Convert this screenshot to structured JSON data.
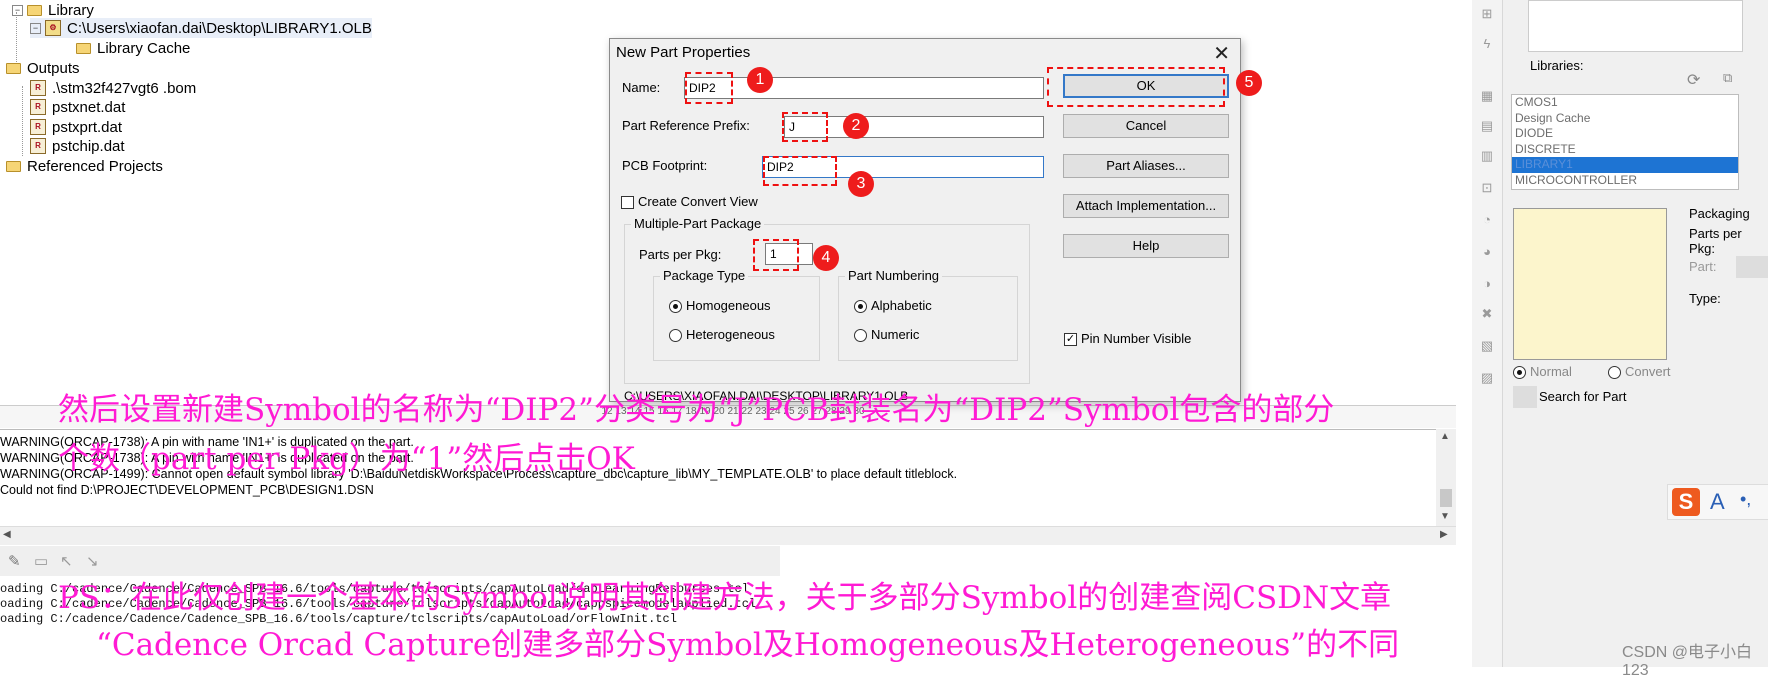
{
  "tree": {
    "items": [
      {
        "label": "Library",
        "type": "folder"
      },
      {
        "label": "C:\\Users\\xiaofan.dai\\Desktop\\LIBRARY1.OLB",
        "type": "olb"
      },
      {
        "label": "Library Cache",
        "type": "folder"
      },
      {
        "label": "Outputs",
        "type": "folder"
      },
      {
        "label": ".\\stm32f427vgt6 .bom",
        "type": "file"
      },
      {
        "label": "pstxnet.dat",
        "type": "file"
      },
      {
        "label": "pstxprt.dat",
        "type": "file"
      },
      {
        "label": "pstchip.dat",
        "type": "file"
      },
      {
        "label": "Referenced Projects",
        "type": "folder"
      }
    ]
  },
  "dialog": {
    "title": "New Part Properties",
    "close_glyph": "✕",
    "name_label": "Name:",
    "name_value": "DIP2",
    "prefix_label": "Part Reference Prefix:",
    "prefix_value": "J",
    "footprint_label": "PCB Footprint:",
    "footprint_value": "DIP2",
    "convert_label": "Create Convert View",
    "multi_title": "Multiple-Part Package",
    "parts_label": "Parts per Pkg:",
    "parts_value": "1",
    "pkg_type_title": "Package Type",
    "homogeneous": "Homogeneous",
    "heterogeneous": "Heterogeneous",
    "numbering_title": "Part Numbering",
    "alphabetic": "Alphabetic",
    "numeric": "Numeric",
    "path": "C:\\USERS\\XIAOFAN.DAI\\DESKTOP\\LIBRARY1.OLB",
    "buttons": {
      "ok": "OK",
      "cancel": "Cancel",
      "aliases": "Part Aliases...",
      "attach": "Attach Implementation...",
      "help": "Help"
    },
    "pin_visible": "Pin Number Visible",
    "badges": [
      "1",
      "2",
      "3",
      "4",
      "5"
    ]
  },
  "right_panel": {
    "libraries_label": "Libraries:",
    "libraries": [
      "CMOS1",
      "Design Cache",
      "DIODE",
      "DISCRETE",
      "LIBRARY1",
      "MICROCONTROLLER"
    ],
    "selected_library": "LIBRARY1",
    "packaging": "Packaging",
    "parts_per_pkg": "Parts per Pkg:",
    "part": "Part:",
    "type": "Type:",
    "normal": "Normal",
    "convert": "Convert",
    "search_for_part": "Search for Part",
    "ime": "A",
    "ime_extra": "•,"
  },
  "ruler": {
    "ticks": [
      "12",
      "13",
      "14",
      "15",
      "16",
      "17",
      "18",
      "19",
      "20",
      "21",
      "22",
      "23",
      "24",
      "25",
      "26",
      "27",
      "28",
      "29",
      "30"
    ]
  },
  "log": {
    "lines": [
      "WARNING(ORCAP-1738): A pin with name 'IN1+' is duplicated on the part.",
      "WARNING(ORCAP-1738): A pin with name 'IN1+' is duplicated on the part.",
      "WARNING(ORCAP-1499): Cannot open default symbol library 'D:\\BaiduNetdiskWorkspace\\Process\\capture_dbc\\capture_lib\\MY_TEMPLATE.OLB' to place default titleblock.",
      "Could not find D:\\PROJECT\\DEVELOPMENT_PCB\\DESIGN1.DSN"
    ]
  },
  "console": {
    "lines": [
      "oading C:/cadence/Cadence/Cadence_SPB_16.6/tools/capture/tclscripts/capAutoLoad/capLearningResources.tcl",
      "oading C:/cadence/Cadence/Cadence_SPB_16.6/tools/capture/tclscripts/capAutoLoad/cappspicemodelapplied.tcl",
      "oading C:/cadence/Cadence/Cadence_SPB_16.6/tools/capture/tclscripts/capAutoLoad/orFlowInit.tcl"
    ]
  },
  "annotations": {
    "line1": "然后设置新建Symbol的名称为“DIP2”分类号为“J”PCB封装名为“DIP2”Symbol包含的部分",
    "line2": "个数（part per Pkg）为“1”然后点击OK",
    "line3": "PS：在此仅创建一个基本的Symbol说明其创建方法，关于多部分Symbol的创建查阅CSDN文章",
    "line4": "“Cadence Orcad Capture创建多部分Symbol及Homogeneous及Heterogeneous”的不同"
  },
  "watermark": "CSDN @电子小白123",
  "colors": {
    "annotation": "#ff1ad4",
    "marker": "#ee1111",
    "selection": "#1e74d3",
    "accent": "#3478c8"
  }
}
